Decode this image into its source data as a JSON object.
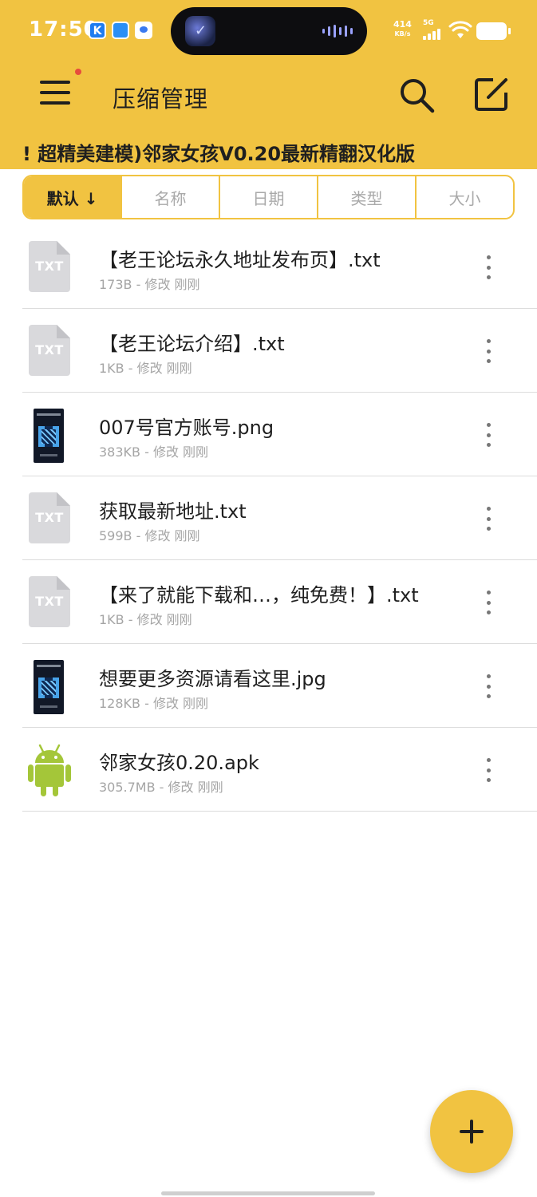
{
  "status_bar": {
    "time": "17:50",
    "app_k_label": "K",
    "network_speed_value": "414",
    "network_speed_unit": "KB/s",
    "network_type": "5G"
  },
  "toolbar": {
    "title": "压缩管理",
    "menu_has_notification": true,
    "marquee_text": "! 超精美建模)邻家女孩V0.20最新精翻汉化版",
    "marquee_prefix": "!"
  },
  "sort_tabs": [
    {
      "label": "默认 ↓",
      "active": true
    },
    {
      "label": "名称",
      "active": false
    },
    {
      "label": "日期",
      "active": false
    },
    {
      "label": "类型",
      "active": false
    },
    {
      "label": "大小",
      "active": false
    }
  ],
  "files": [
    {
      "name": "【老王论坛永久地址发布页】.txt",
      "meta": "173B - 修改 刚刚",
      "icon": "txt-file-icon",
      "icon_label": "TXT"
    },
    {
      "name": "【老王论坛介绍】.txt",
      "meta": "1KB - 修改 刚刚",
      "icon": "txt-file-icon",
      "icon_label": "TXT"
    },
    {
      "name": "007号官方账号.png",
      "meta": "383KB - 修改 刚刚",
      "icon": "image-thumbnail-icon"
    },
    {
      "name": "获取最新地址.txt",
      "meta": "599B - 修改 刚刚",
      "icon": "txt-file-icon",
      "icon_label": "TXT"
    },
    {
      "name": "【来了就能下载和…，纯免费！】.txt",
      "meta": "1KB - 修改 刚刚",
      "icon": "txt-file-icon",
      "icon_label": "TXT"
    },
    {
      "name": "想要更多资源请看这里.jpg",
      "meta": "128KB - 修改 刚刚",
      "icon": "image-thumbnail-icon"
    },
    {
      "name": "邻家女孩0.20.apk",
      "meta": "305.7MB - 修改 刚刚",
      "icon": "android-apk-icon"
    }
  ],
  "fab": {
    "icon": "plus-icon"
  },
  "colors": {
    "accent": "#f1c341",
    "text_primary": "#1f1f1f",
    "text_secondary": "#a5a5a5",
    "divider": "#dcdcdc",
    "android_green": "#a4c639"
  }
}
